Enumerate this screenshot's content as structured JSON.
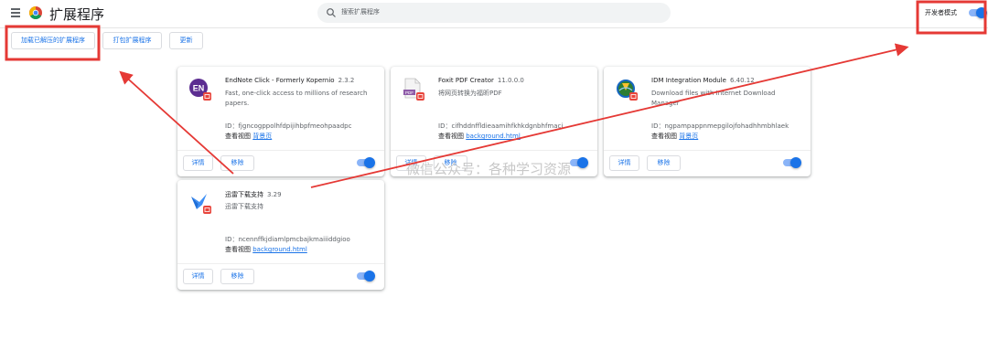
{
  "header": {
    "title": "扩展程序",
    "search_placeholder": "搜索扩展程序",
    "dev_mode_label": "开发者模式",
    "dev_mode_on": true
  },
  "toolbar": {
    "load_unpacked": "加载已解压的扩展程序",
    "pack": "打包扩展程序",
    "update": "更新"
  },
  "common": {
    "id_prefix": "ID：",
    "views_label": "查看视图",
    "details": "详情",
    "remove": "移除"
  },
  "extensions": [
    {
      "name": "EndNote Click - Formerly Kopernio",
      "version": "2.3.2",
      "description": "Fast, one-click access to millions of research papers.",
      "id": "fjgncogppolhfdpijihbpfmeohpaadpc",
      "view_link": "背景页",
      "enabled": true,
      "icon": "endnote-en-icon"
    },
    {
      "name": "Foxit PDF Creator",
      "version": "11.0.0.0",
      "description": "将网页转换为福昕PDF",
      "id": "cifhddnffldieaamihfkhkdgnbhfmaci",
      "view_link": "background.html",
      "enabled": true,
      "icon": "pdf-file-icon"
    },
    {
      "name": "IDM Integration Module",
      "version": "6.40.12",
      "description": "Download files with Internet Download Manager",
      "id": "ngpampappnmepgilojfohadhhmbhlaek",
      "view_link": "背景页",
      "enabled": true,
      "icon": "idm-globe-icon"
    },
    {
      "name": "迅雷下载支持",
      "version": "3.29",
      "description": "迅雷下载支持",
      "id": "ncennffkjdiamlpmcbajkmaiiiddgioo",
      "view_link": "background.html",
      "enabled": true,
      "icon": "thunder-bird-icon"
    }
  ],
  "watermark": "微信公众号：各种学习资源",
  "colors": {
    "accent": "#1a73e8",
    "annotation": "#e53935"
  }
}
